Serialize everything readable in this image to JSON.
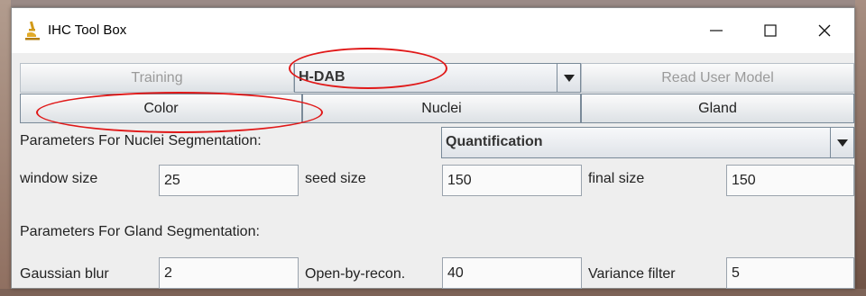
{
  "window": {
    "title": "IHC Tool Box"
  },
  "toolbar": {
    "training_label": "Training",
    "stain_selected": "H-DAB",
    "read_user_model_label": "Read User Model"
  },
  "tabs": [
    "Color",
    "Nuclei",
    "Gland"
  ],
  "nuclei_params": {
    "header": "Parameters For Nuclei Segmentation:",
    "mode_selected": "Quantification",
    "window_size_label": "window size",
    "window_size_value": "25",
    "seed_size_label": "seed size",
    "seed_size_value": "150",
    "final_size_label": "final size",
    "final_size_value": "150"
  },
  "gland_params": {
    "header": "Parameters For Gland Segmentation:",
    "gaussian_blur_label": "Gaussian blur",
    "gaussian_blur_value": "2",
    "open_by_recon_label": "Open-by-recon.",
    "open_by_recon_value": "40",
    "variance_filter_label": "Variance filter",
    "variance_filter_value": "5"
  },
  "icons": {
    "app": "microscope-icon",
    "minimize": "minimize-icon",
    "maximize": "maximize-icon",
    "close": "close-icon",
    "dropdown": "chevron-down-icon"
  },
  "colors": {
    "annotation": "#e01818",
    "app_icon": "#d29a18"
  }
}
